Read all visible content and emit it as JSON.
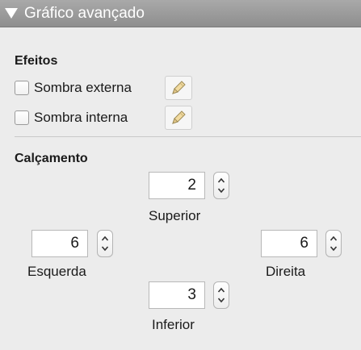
{
  "header": {
    "title": "Gráfico avançado"
  },
  "effects": {
    "title": "Efeitos",
    "outer_shadow": {
      "label": "Sombra externa",
      "checked": false
    },
    "inner_shadow": {
      "label": "Sombra interna",
      "checked": false
    }
  },
  "padding": {
    "title": "Calçamento",
    "top": {
      "label": "Superior",
      "value": "2"
    },
    "left": {
      "label": "Esquerda",
      "value": "6"
    },
    "right": {
      "label": "Direita",
      "value": "6"
    },
    "bottom": {
      "label": "Inferior",
      "value": "3"
    }
  },
  "icons": {
    "disclosure": "disclosure-triangle-down-icon",
    "edit": "pencil-icon",
    "stepper": "up-down-chevron-icon"
  }
}
